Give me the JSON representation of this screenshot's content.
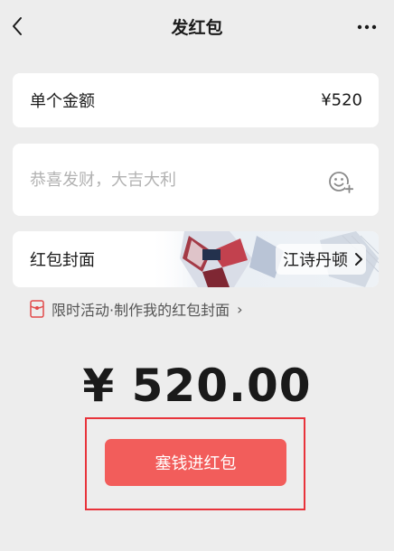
{
  "header": {
    "title": "发红包",
    "back_icon": "chevron-left-icon",
    "more_icon": "more-dots-icon"
  },
  "amount": {
    "label": "单个金额",
    "value": "¥520"
  },
  "greeting": {
    "placeholder": "恭喜发财，大吉大利",
    "value": "",
    "emoji_icon": "emoji-add-icon"
  },
  "cover": {
    "label": "红包封面",
    "selected": "江诗丹顿",
    "arrow_icon": "chevron-right-icon"
  },
  "promo": {
    "icon": "red-packet-cover-icon",
    "text": "限时活动·制作我的红包封面",
    "arrow": "›"
  },
  "total": {
    "display": "¥ 520.00"
  },
  "submit": {
    "label": "塞钱进红包"
  },
  "colors": {
    "accent_red": "#f25d5b",
    "highlight_border": "#e8333b",
    "background": "#ededed"
  }
}
